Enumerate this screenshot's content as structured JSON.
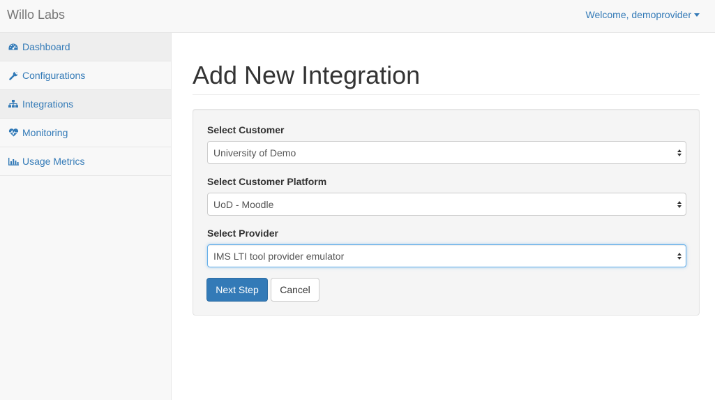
{
  "navbar": {
    "brand": "Willo Labs",
    "user_menu": "Welcome, demoprovider"
  },
  "sidebar": {
    "items": [
      {
        "label": "Dashboard",
        "icon": "dashboard-icon"
      },
      {
        "label": "Configurations",
        "icon": "wrench-icon"
      },
      {
        "label": "Integrations",
        "icon": "sitemap-icon"
      },
      {
        "label": "Monitoring",
        "icon": "heartbeat-icon"
      },
      {
        "label": "Usage Metrics",
        "icon": "bar-chart-icon"
      }
    ]
  },
  "main": {
    "title": "Add New Integration",
    "form": {
      "customer": {
        "label": "Select Customer",
        "value": "University of Demo"
      },
      "platform": {
        "label": "Select Customer Platform",
        "value": "UoD - Moodle"
      },
      "provider": {
        "label": "Select Provider",
        "value": "IMS LTI tool provider emulator"
      },
      "next_label": "Next Step",
      "cancel_label": "Cancel"
    }
  },
  "colors": {
    "link": "#337ab7",
    "primary_button": "#337ab7",
    "well_background": "#f5f5f5",
    "focus_border": "#66afe9"
  }
}
